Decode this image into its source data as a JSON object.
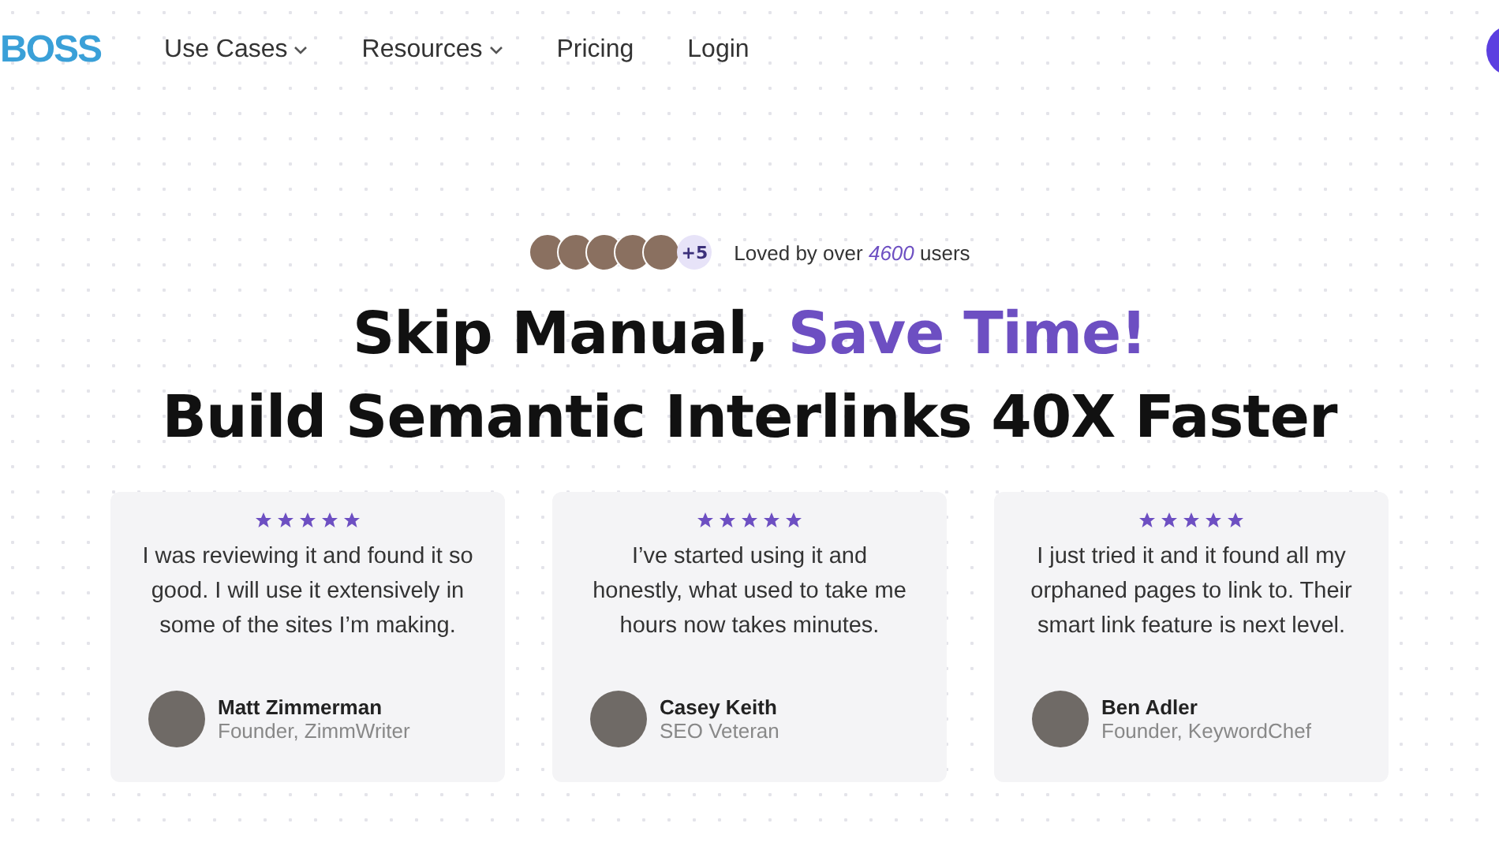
{
  "nav": {
    "logo": "BOSS",
    "items": [
      {
        "label": "Use Cases",
        "dropdown": true
      },
      {
        "label": "Resources",
        "dropdown": true
      },
      {
        "label": "Pricing",
        "dropdown": false
      },
      {
        "label": "Login",
        "dropdown": false
      }
    ]
  },
  "social_proof": {
    "more": "+5",
    "text_before": "Loved by over",
    "count": "4600",
    "text_after": "users"
  },
  "headline": {
    "plain": "Skip Manual,",
    "highlight": "Save Time!",
    "line_2": "Build Semantic Interlinks 40X Faster"
  },
  "testimonials": [
    {
      "stars": 5,
      "quote": "I was reviewing it and found it so good. I will use it extensively in some of the sites I’m making.",
      "name": "Matt Zimmerman",
      "role": "Founder, ZimmWriter"
    },
    {
      "stars": 5,
      "quote": "I’ve started using it and honestly, what used to take me hours now takes minutes.",
      "name": "Casey Keith",
      "role": "SEO Veteran"
    },
    {
      "stars": 5,
      "quote": "I just tried it and it found all my orphaned pages to link to. Their smart link feature is next level.",
      "name": "Ben Adler",
      "role": "Founder, KeywordChef"
    }
  ]
}
